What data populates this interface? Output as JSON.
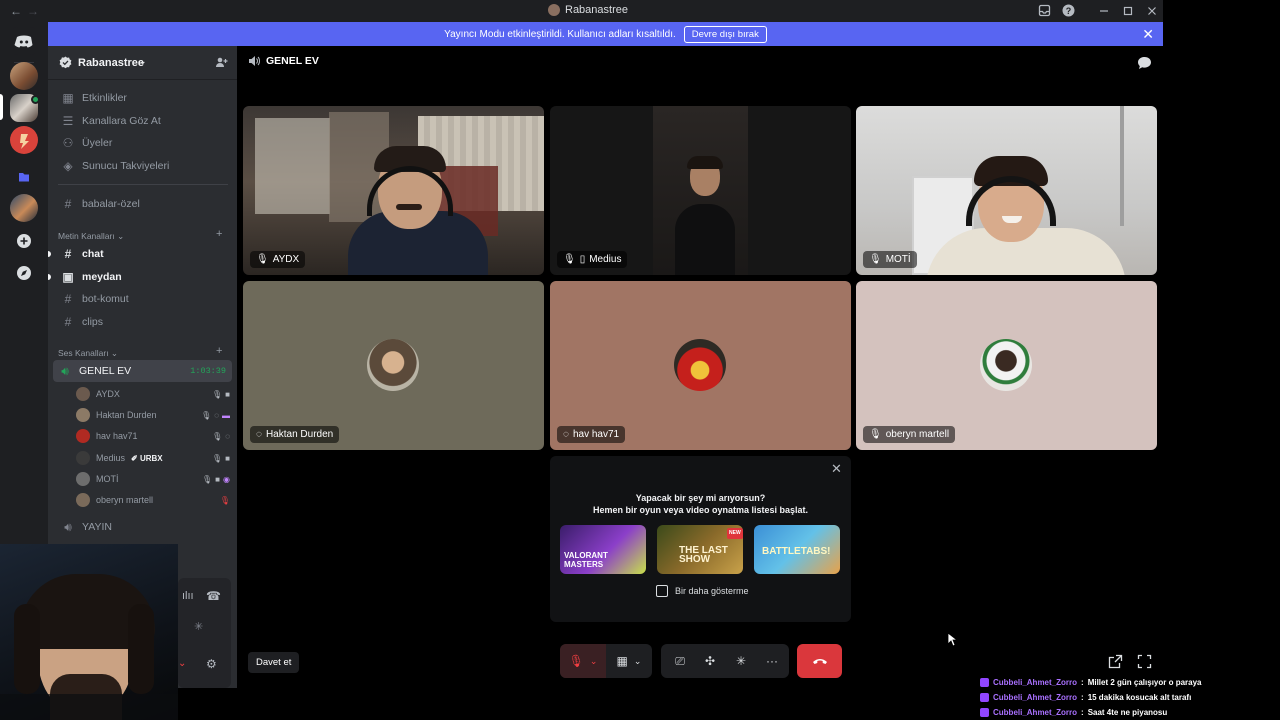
{
  "titlebar": {
    "title": "Rabanastree",
    "back": "←",
    "forward": "→"
  },
  "notice": {
    "text": "Yayıncı Modu etkinleştirildi. Kullanıcı adları kısaltıldı.",
    "button": "Devre dışı bırak",
    "color": "#5865f2"
  },
  "server": {
    "name": "Rabanastree",
    "menu": [
      {
        "label": "Etkinlikler",
        "icon": "calendar-icon"
      },
      {
        "label": "Kanallara Göz At",
        "icon": "browse-channels-icon"
      },
      {
        "label": "Üyeler",
        "icon": "members-icon"
      },
      {
        "label": "Sunucu Takviyeleri",
        "icon": "boost-icon"
      }
    ],
    "top_channel": "babalar-özel",
    "text_category": "Metin Kanalları",
    "text_channels": [
      {
        "name": "chat",
        "unread": true
      },
      {
        "name": "meydan",
        "unread": true
      },
      {
        "name": "bot-komut",
        "unread": false
      },
      {
        "name": "clips",
        "unread": false
      }
    ],
    "voice_category": "Ses Kanalları",
    "voice_channel": {
      "name": "GENEL EV",
      "time": "1:03:39",
      "users": [
        {
          "name": "AYDX",
          "color": "#6b5a4e"
        },
        {
          "name": "Haktan Durden",
          "color": "#8c7a66"
        },
        {
          "name": "hav hav71",
          "color": "#b02a22"
        },
        {
          "name": "Medius",
          "tag": "URBX",
          "color": "#3a3a3a"
        },
        {
          "name": "MOTİ",
          "color": "#6d6d6d"
        },
        {
          "name": "oberyn martell",
          "color": "#7a6a5a"
        }
      ]
    },
    "other_voice": "YAYIN"
  },
  "stage": {
    "title": "GENEL EV",
    "tiles": [
      {
        "name": "AYDX",
        "kind": "video"
      },
      {
        "name": "Medius",
        "kind": "video"
      },
      {
        "name": "MOTİ",
        "kind": "video"
      },
      {
        "name": "Haktan Durden",
        "kind": "avatar",
        "bg": "#6e6a5a"
      },
      {
        "name": "hav hav71",
        "kind": "avatar",
        "bg": "#a17564"
      },
      {
        "name": "oberyn martell",
        "kind": "avatar",
        "bg": "#d4c2be"
      }
    ]
  },
  "activity": {
    "line1": "Yapacak bir şey mi arıyorsun?",
    "line2": "Hemen bir oyun veya video oynatma listesi başlat.",
    "cards": [
      {
        "label": "VALORANT MASTERS"
      },
      {
        "label": "THE LAST SHOW",
        "badge": "NEW"
      },
      {
        "label": "BATTLETABS!"
      }
    ],
    "checkbox": "Bir daha gösterme"
  },
  "controls": {
    "invite": "Davet et"
  },
  "chat_overlay": [
    {
      "user": "Cubbeli_Ahmet_Zorro",
      "message": "Millet 2 gün çalışıyor o paraya"
    },
    {
      "user": "Cubbeli_Ahmet_Zorro",
      "message": "15 dakika kosucak alt tarafı"
    },
    {
      "user": "Cubbeli_Ahmet_Zorro",
      "message": "Saat 4te ne piyanosu"
    }
  ]
}
